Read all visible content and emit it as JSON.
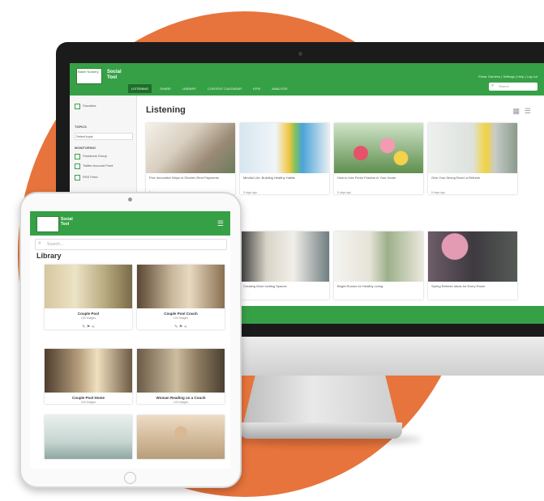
{
  "desktop": {
    "app_title": "Social Tool",
    "logo_text": "Baker Nursery",
    "nav": [
      "LISTENING",
      "SHARE",
      "LIBRARY",
      "CONTENT CALENDAR",
      "KPIS",
      "ANALYSIS"
    ],
    "user_info": "Elmar Gardens | Settings | Help | Log out",
    "search_placeholder": "Search",
    "sidebar": {
      "item1": "Favorites",
      "section": "TOPICS",
      "select": "Select topic",
      "subsection": "MONITORING",
      "sources": [
        "Facebook Group",
        "Twitter Account Feed",
        "RSS Feed"
      ]
    },
    "section_title": "Listening",
    "cards": [
      {
        "caption": "Five Innovative Ways to Shorten Rent Payments",
        "meta": "5 days ago"
      },
      {
        "caption": "Mindful Life: Building Healthy Habits",
        "meta": "5 days ago"
      },
      {
        "caption": "How to Use Fresh Flowers in Your Home",
        "meta": "5 days ago"
      },
      {
        "caption": "Give Your Dining Room a Refresh",
        "meta": "5 days ago"
      },
      {
        "caption": "Creating More Inviting Spaces",
        "meta": ""
      },
      {
        "caption": "Bright Rooms for Healthy Living",
        "meta": ""
      },
      {
        "caption": "Fresh Takes on Compact Kitchens",
        "meta": ""
      },
      {
        "caption": "Spring Refresh Ideas for Every Room",
        "meta": ""
      }
    ],
    "footer": "© 2019 Elmar Gardens. All rights reserved."
  },
  "tablet": {
    "app_title": "Social Tool",
    "search_placeholder": "Search...",
    "section_title": "Library",
    "items": [
      {
        "title": "Couple Pool",
        "subtitle": "100 Images"
      },
      {
        "title": "Couple Pool Couch",
        "subtitle": "100 Images"
      },
      {
        "title": "Couple Pool Home",
        "subtitle": "100 Images"
      },
      {
        "title": "Woman Reading on a Couch",
        "subtitle": "100 Images"
      }
    ]
  },
  "colors": {
    "brand_green": "#36a047",
    "accent_orange": "#e7743c"
  }
}
